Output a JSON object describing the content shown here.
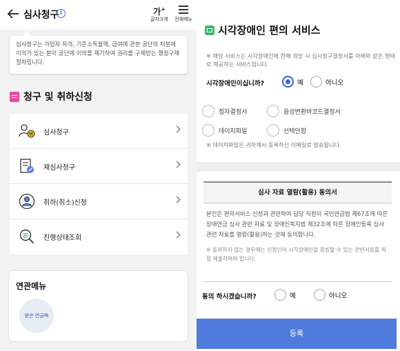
{
  "left": {
    "header": {
      "title": "심사청구",
      "font_size_label": "글자크게",
      "font_size_glyph": "가",
      "font_size_sup": "+",
      "menu_label": "전체메뉴"
    },
    "notice": {
      "text": "심사청구는 가입자 자격, 기준소득월액, 급여에 관한 공단의 처분에 이의가 있는 분이 공단에 이의를 제기하여 권리를 구제받는 행정구제 절차입니다."
    },
    "section": {
      "title": "청구 및 취하신청"
    },
    "menu_items": [
      {
        "label": "심사청구",
        "icon": "person-coin-icon"
      },
      {
        "label": "재심사청구",
        "icon": "document-pen-icon"
      },
      {
        "label": "취하(취소)신청",
        "icon": "person-circle-icon"
      },
      {
        "label": "진행상태조회",
        "icon": "magnifier-list-icon"
      }
    ],
    "related": {
      "title": "연관메뉴",
      "items": [
        {
          "label": "받은 연금액"
        }
      ]
    }
  },
  "right": {
    "title": "시각장애인 편의 서비스",
    "note": "※ 해당 서비스는 시각장애인에 한해 희망 시 심사청구결정서를 아래와 같은 형태로 제공하는 서비스입니다.",
    "question": "시각장애인이십니까?",
    "yes_label": "예",
    "no_label": "아니오",
    "selected": "예",
    "formats": [
      "점자결정서",
      "음성변환바코드결정서",
      "데이지파일",
      "선택안함"
    ],
    "daisy_note": "※ 데이지파일은 귀하께서 등록하신 이메일로 발송됩니다.",
    "agreement": {
      "title": "심사 자료 열람(활용) 동의서",
      "body": "본인은 편의서비스 신청과 관련하여 담당 직원이 국민연금법 제67조에 따른 장애연금 심사 관련 자료 및 장애인복지법 제32조에 따른 장애인등록 심사 관련 자료를 열람(활용)하는 것에 동의합니다.",
      "note": "※ 동의하지 않는 경우에는 신청인이 시각장애인을 증빙할 수 있는 관련서류를 직접 제출하여야 합니다."
    },
    "consent_question": "동의 하시겠습니까?",
    "consent_yes": "예",
    "consent_no": "아니오",
    "submit_label": "등록"
  },
  "colors": {
    "accent": "#4f7bdc",
    "radio_selected": "#3a66d6",
    "section_icon": "#e94ba0",
    "service_icon": "#3cb56b"
  }
}
